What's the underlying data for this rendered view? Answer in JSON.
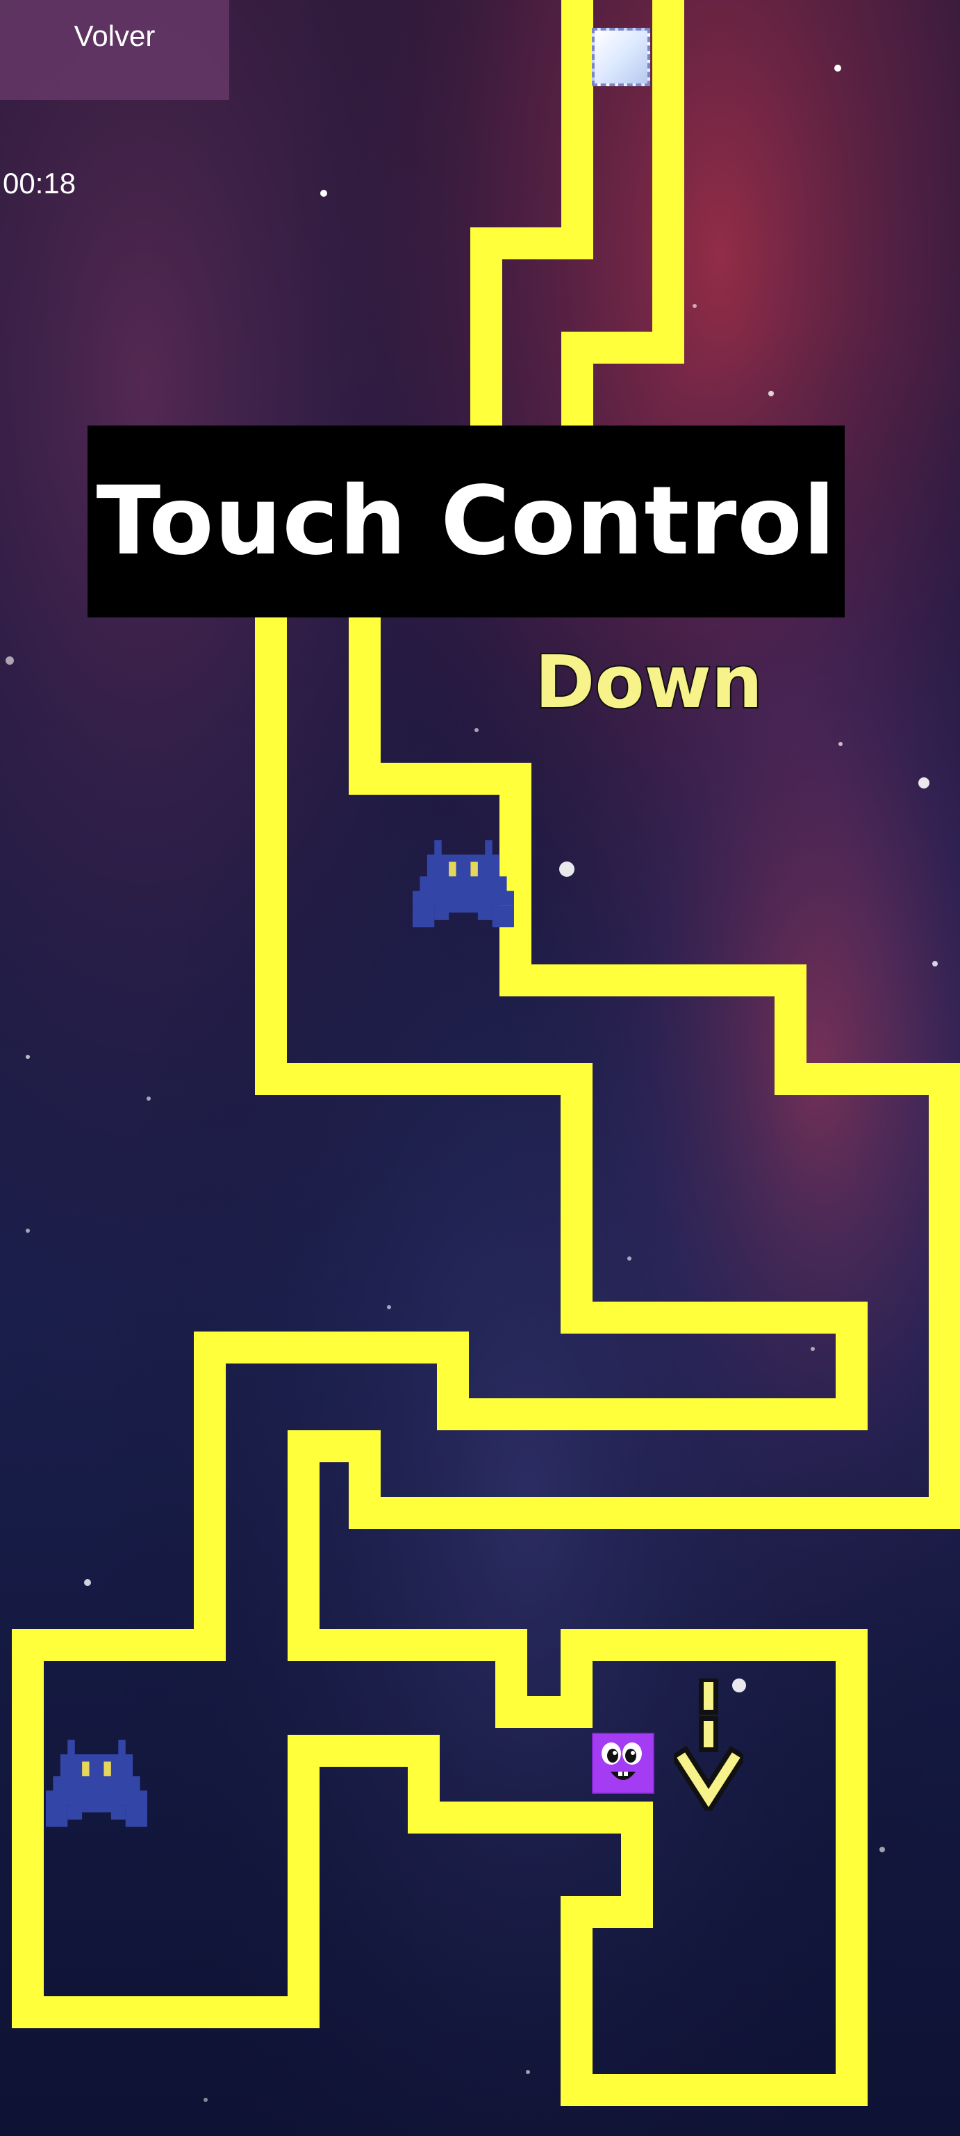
{
  "header": {
    "back_label": "Volver",
    "timer": "00:18"
  },
  "banner": {
    "title": "Touch Control"
  },
  "hint": {
    "direction": "Down"
  },
  "sprites": {
    "player": "purple-smiling-block",
    "goal": "light-blue-goal-tile",
    "enemy": "blue-pixel-invader",
    "arrow": "down-arrow-icon"
  },
  "colors": {
    "maze_path": "#ffff3b",
    "enemy": "#3346a8",
    "player": "#a33cf2",
    "label_text": "#f7f38a",
    "banner_bg": "#000000",
    "back_button_bg": "#6e3c6e"
  }
}
